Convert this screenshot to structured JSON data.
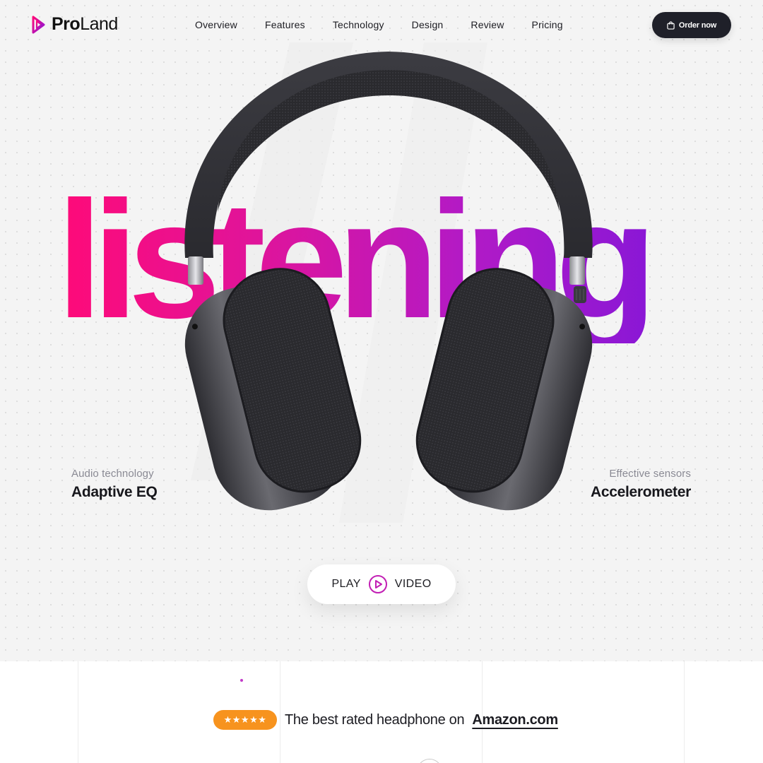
{
  "brand": {
    "name_bold": "Pro",
    "name_regular": "Land"
  },
  "nav": {
    "items": [
      {
        "label": "Overview"
      },
      {
        "label": "Features"
      },
      {
        "label": "Technology"
      },
      {
        "label": "Design"
      },
      {
        "label": "Review"
      },
      {
        "label": "Pricing"
      }
    ]
  },
  "order_button": {
    "label": "Order now"
  },
  "hero": {
    "headline": "listening",
    "gradient_colors": [
      "#ff0a78",
      "#e0149a",
      "#b21ac6",
      "#7a16dc"
    ]
  },
  "features": {
    "left": {
      "subtitle": "Audio technology",
      "title": "Adaptive EQ"
    },
    "right": {
      "subtitle": "Effective sensors",
      "title": "Accelerometer"
    }
  },
  "play_video": {
    "left_label": "PLAY",
    "right_label": "VIDEO",
    "accent": "#c21fb4"
  },
  "rating": {
    "stars": "★★★★★",
    "text": "The best rated headphone on",
    "link": "Amazon.com",
    "badge_color": "#f7931e"
  },
  "colors": {
    "dark_button": "#1f2029",
    "pink": "#ff0a78",
    "purple": "#7a16dc"
  }
}
